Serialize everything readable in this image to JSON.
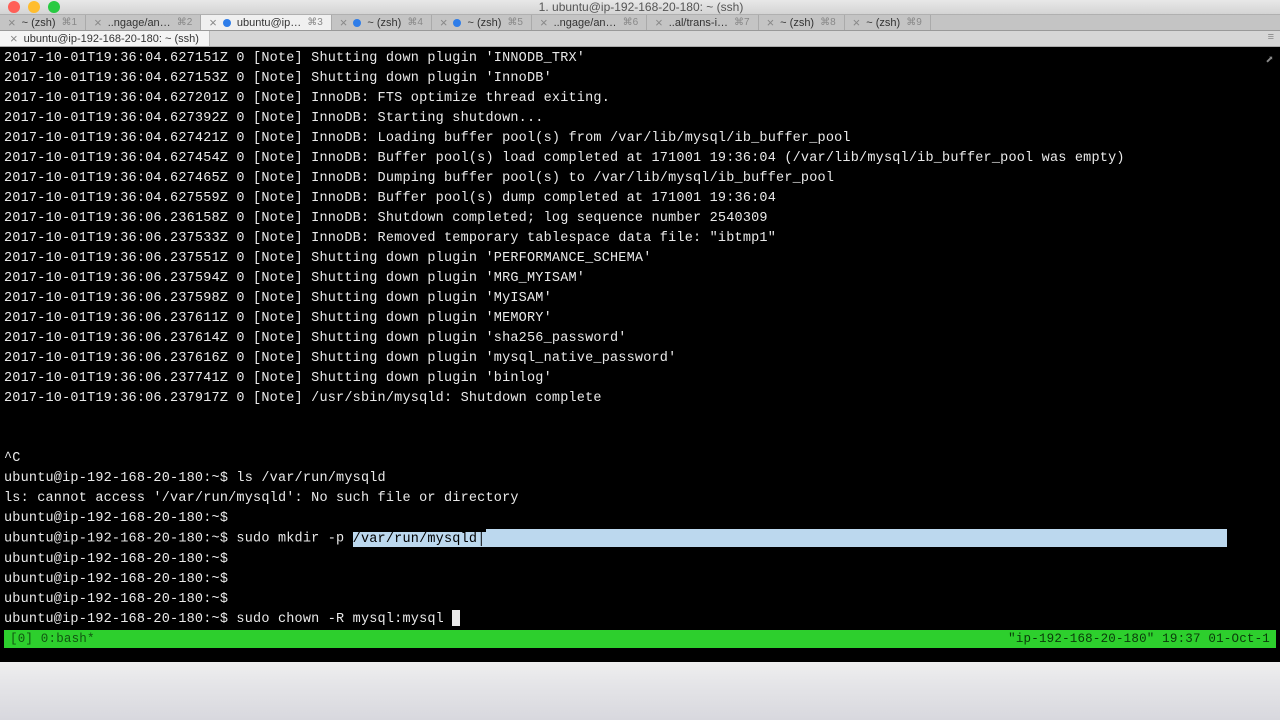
{
  "window": {
    "title": "1. ubuntu@ip-192-168-20-180: ~ (ssh)"
  },
  "tabs": [
    {
      "label": "~ (zsh)",
      "shortcut": "⌘1",
      "dot": null,
      "active": false
    },
    {
      "label": "..ngage/an…",
      "shortcut": "⌘2",
      "dot": null,
      "active": false
    },
    {
      "label": "ubuntu@ip…",
      "shortcut": "⌘3",
      "dot": "blue",
      "active": true
    },
    {
      "label": "~ (zsh)",
      "shortcut": "⌘4",
      "dot": "blue",
      "active": false
    },
    {
      "label": "~ (zsh)",
      "shortcut": "⌘5",
      "dot": "blue",
      "active": false
    },
    {
      "label": "..ngage/an…",
      "shortcut": "⌘6",
      "dot": null,
      "active": false
    },
    {
      "label": "..al/trans-i…",
      "shortcut": "⌘7",
      "dot": null,
      "active": false
    },
    {
      "label": "~ (zsh)",
      "shortcut": "⌘8",
      "dot": null,
      "active": false
    },
    {
      "label": "~ (zsh)",
      "shortcut": "⌘9",
      "dot": null,
      "active": false
    }
  ],
  "subtab": {
    "label": "ubuntu@ip-192-168-20-180: ~ (ssh)"
  },
  "terminal_lines": [
    "2017-10-01T19:36:04.627151Z 0 [Note] Shutting down plugin 'INNODB_TRX'",
    "2017-10-01T19:36:04.627153Z 0 [Note] Shutting down plugin 'InnoDB'",
    "2017-10-01T19:36:04.627201Z 0 [Note] InnoDB: FTS optimize thread exiting.",
    "2017-10-01T19:36:04.627392Z 0 [Note] InnoDB: Starting shutdown...",
    "2017-10-01T19:36:04.627421Z 0 [Note] InnoDB: Loading buffer pool(s) from /var/lib/mysql/ib_buffer_pool",
    "2017-10-01T19:36:04.627454Z 0 [Note] InnoDB: Buffer pool(s) load completed at 171001 19:36:04 (/var/lib/mysql/ib_buffer_pool was empty)",
    "2017-10-01T19:36:04.627465Z 0 [Note] InnoDB: Dumping buffer pool(s) to /var/lib/mysql/ib_buffer_pool",
    "2017-10-01T19:36:04.627559Z 0 [Note] InnoDB: Buffer pool(s) dump completed at 171001 19:36:04",
    "2017-10-01T19:36:06.236158Z 0 [Note] InnoDB: Shutdown completed; log sequence number 2540309",
    "2017-10-01T19:36:06.237533Z 0 [Note] InnoDB: Removed temporary tablespace data file: \"ibtmp1\"",
    "2017-10-01T19:36:06.237551Z 0 [Note] Shutting down plugin 'PERFORMANCE_SCHEMA'",
    "2017-10-01T19:36:06.237594Z 0 [Note] Shutting down plugin 'MRG_MYISAM'",
    "2017-10-01T19:36:06.237598Z 0 [Note] Shutting down plugin 'MyISAM'",
    "2017-10-01T19:36:06.237611Z 0 [Note] Shutting down plugin 'MEMORY'",
    "2017-10-01T19:36:06.237614Z 0 [Note] Shutting down plugin 'sha256_password'",
    "2017-10-01T19:36:06.237616Z 0 [Note] Shutting down plugin 'mysql_native_password'",
    "2017-10-01T19:36:06.237741Z 0 [Note] Shutting down plugin 'binlog'",
    "2017-10-01T19:36:06.237917Z 0 [Note] /usr/sbin/mysqld: Shutdown complete",
    "",
    "",
    "^C",
    "ubuntu@ip-192-168-20-180:~$ ls /var/run/mysqld",
    "ls: cannot access '/var/run/mysqld': No such file or directory",
    "ubuntu@ip-192-168-20-180:~$"
  ],
  "selected_line": {
    "prefix": "ubuntu@ip-192-168-20-180:~$ sudo mkdir -p ",
    "selected": "/var/run/mysqld"
  },
  "after_lines": [
    "ubuntu@ip-192-168-20-180:~$",
    "ubuntu@ip-192-168-20-180:~$",
    "ubuntu@ip-192-168-20-180:~$"
  ],
  "current_line": {
    "text": "ubuntu@ip-192-168-20-180:~$ sudo chown -R mysql:mysql "
  },
  "status_bar": {
    "left": "[0] 0:bash*",
    "right": "\"ip-192-168-20-180\" 19:37 01-Oct-1"
  }
}
